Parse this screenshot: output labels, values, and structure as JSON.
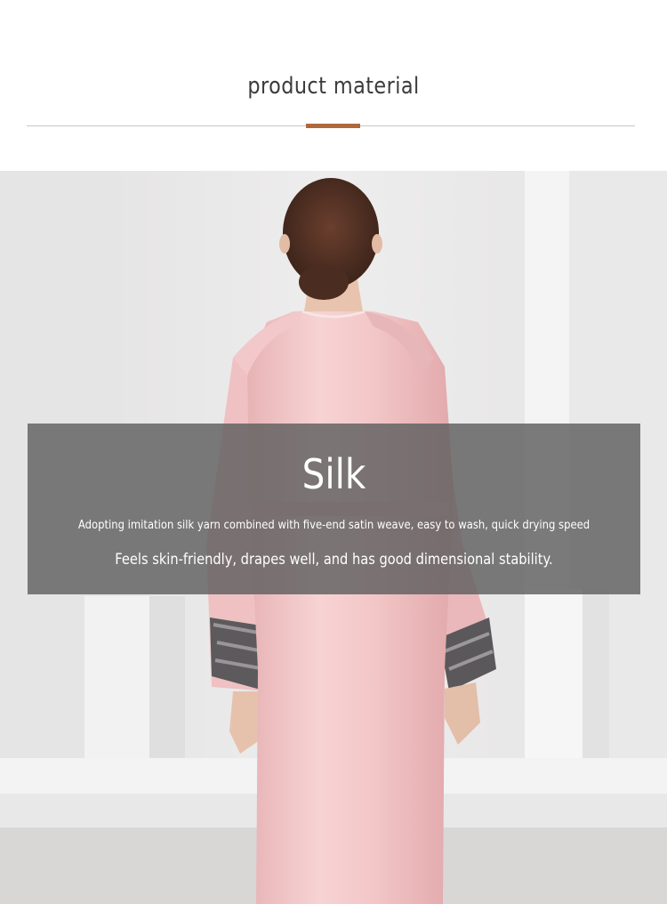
{
  "section": {
    "title": "product material",
    "accent_color": "#b0683b"
  },
  "photo": {
    "subject_icon": "model-in-pink-silk-robe-back-view"
  },
  "material": {
    "name": "Silk",
    "description_line1": "Adopting imitation silk yarn combined with five-end satin weave, easy to wash, quick drying speed",
    "description_line2": "Feels skin-friendly, drapes well, and has good dimensional stability."
  }
}
